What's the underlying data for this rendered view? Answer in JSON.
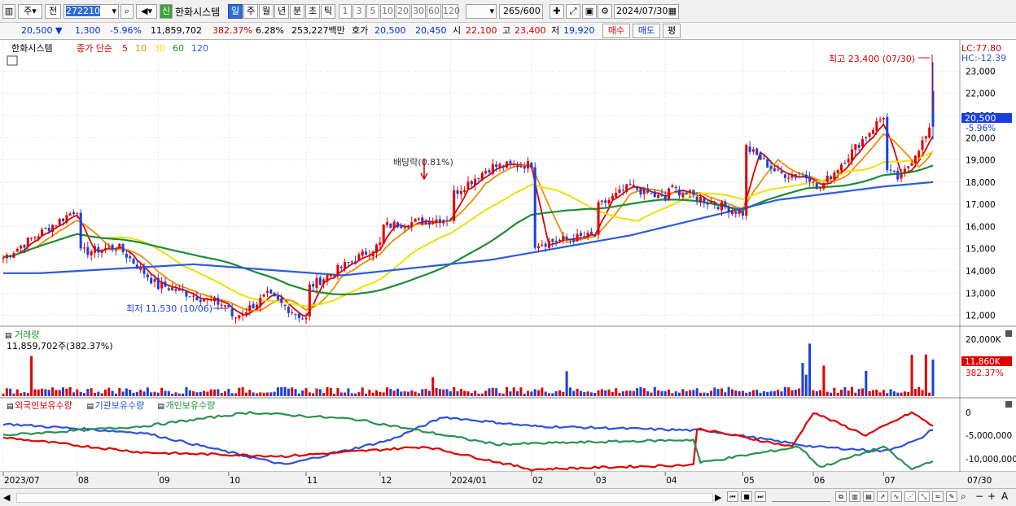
{
  "toolbar": {
    "market_type": "주",
    "market_prev": "전",
    "code": "272210",
    "stock_name": "한화시스템",
    "new_badge": "신",
    "periods": [
      "일",
      "주",
      "월",
      "년",
      "분",
      "초",
      "틱"
    ],
    "selected_period": "일",
    "intervals": [
      "1",
      "3",
      "5",
      "10",
      "20",
      "30",
      "60",
      "120"
    ],
    "count": "265",
    "count_total": "/600",
    "date": "2024/07/30"
  },
  "quote": {
    "price": "20,500",
    "change": "1,300",
    "change_pct": "-5.96%",
    "volume": "11,859,702",
    "volume_ratio": "382.37%",
    "turnover": "6.28%",
    "amount": "253,227백만",
    "bid_label": "호가",
    "ask": "20,500",
    "bid": "20,450",
    "open_label": "시",
    "open": "22,100",
    "high_label": "고",
    "high": "23,400",
    "low_label": "저",
    "low": "19,920",
    "buy_label": "매수",
    "sell_label": "매도",
    "eval_label": "평"
  },
  "legend": {
    "name": "한화시스템",
    "text": "종가 단순",
    "ma_periods": [
      "5",
      "10",
      "30",
      "60",
      "120"
    ],
    "lc": "LC:77.80",
    "hc": "HC:-12.39"
  },
  "annotations": {
    "high": "최고 23,400 (07/30)",
    "low": "최저 11,530 (10/06)",
    "dividend": "배당락(0.81%)"
  },
  "volume_panel": {
    "title": "거래량",
    "value": "11,859,702주(382.37%)",
    "axis_max": "20,000K",
    "last": "11,860K",
    "last_pct": "382.37%"
  },
  "holdings_panel": {
    "labels": [
      "외국인보유수량",
      "기관보유수량",
      "개인보유수량"
    ],
    "axis": [
      "0",
      "-5,000,000",
      "-10,000,000"
    ]
  },
  "price_axis": [
    "23,000",
    "22,000",
    "21,000",
    "20,000",
    "19,000",
    "18,000",
    "17,000",
    "16,000",
    "15,000",
    "14,000",
    "13,000",
    "12,000"
  ],
  "price_tag": {
    "price": "20,500",
    "pct": "-5.96%"
  },
  "date_axis": {
    "labels": [
      "2023/07",
      "08",
      "09",
      "10",
      "11",
      "12",
      "2024/01",
      "02",
      "03",
      "04",
      "05",
      "06",
      "07"
    ],
    "last": "07/30"
  },
  "colors": {
    "up": "#e00000",
    "down": "#1a3fe0",
    "ma5": "#e00000",
    "ma10": "#f08c00",
    "ma30": "#f0e000",
    "ma60": "#1e8c32",
    "ma120": "#2a5ce0",
    "foreign": "#2a50e0",
    "inst": "#e00000",
    "indiv": "#2a9050"
  },
  "chart_data": {
    "type": "candlestick",
    "x": [
      "2023/07",
      "2023/08",
      "2023/09",
      "2023/10",
      "2023/11",
      "2023/12",
      "2024/01",
      "2024/02",
      "2024/03",
      "2024/04",
      "2024/05",
      "2024/06",
      "2024/07"
    ],
    "close_path": [
      [
        "2023/07",
        14600
      ],
      [
        "2023/07",
        16800
      ],
      [
        "2023/08",
        14800
      ],
      [
        "2023/08",
        15100
      ],
      [
        "2023/08",
        13300
      ],
      [
        "2023/09",
        13400
      ],
      [
        "2023/09",
        12400
      ],
      [
        "2023/10",
        11700
      ],
      [
        "2023/10",
        12900
      ],
      [
        "2023/10",
        11800
      ],
      [
        "2023/11",
        13200
      ],
      [
        "2023/11",
        15200
      ],
      [
        "2023/12",
        16000
      ],
      [
        "2023/12",
        16400
      ],
      [
        "2024/01",
        17400
      ],
      [
        "2024/01",
        18700
      ],
      [
        "2024/01",
        18800
      ],
      [
        "2024/02",
        15200
      ],
      [
        "2024/02",
        15600
      ],
      [
        "2024/03",
        16800
      ],
      [
        "2024/03",
        17800
      ],
      [
        "2024/03",
        17200
      ],
      [
        "2024/04",
        17800
      ],
      [
        "2024/04",
        16600
      ],
      [
        "2024/05",
        19700
      ],
      [
        "2024/05",
        18400
      ],
      [
        "2024/05",
        18200
      ],
      [
        "2024/06",
        17400
      ],
      [
        "2024/06",
        21000
      ],
      [
        "2024/07",
        18600
      ],
      [
        "2024/07",
        18100
      ],
      [
        "2024/07",
        19400
      ],
      [
        "2024/07",
        20500
      ]
    ],
    "ma120_path": [
      [
        "2023/07",
        13900
      ],
      [
        "2023/09",
        14300
      ],
      [
        "2023/11",
        13800
      ],
      [
        "2024/01",
        14500
      ],
      [
        "2024/03",
        15600
      ],
      [
        "2024/05",
        17200
      ],
      [
        "2024/07",
        17800
      ],
      [
        "2024/07",
        18000
      ]
    ],
    "ylim": [
      11400,
      23600
    ]
  }
}
